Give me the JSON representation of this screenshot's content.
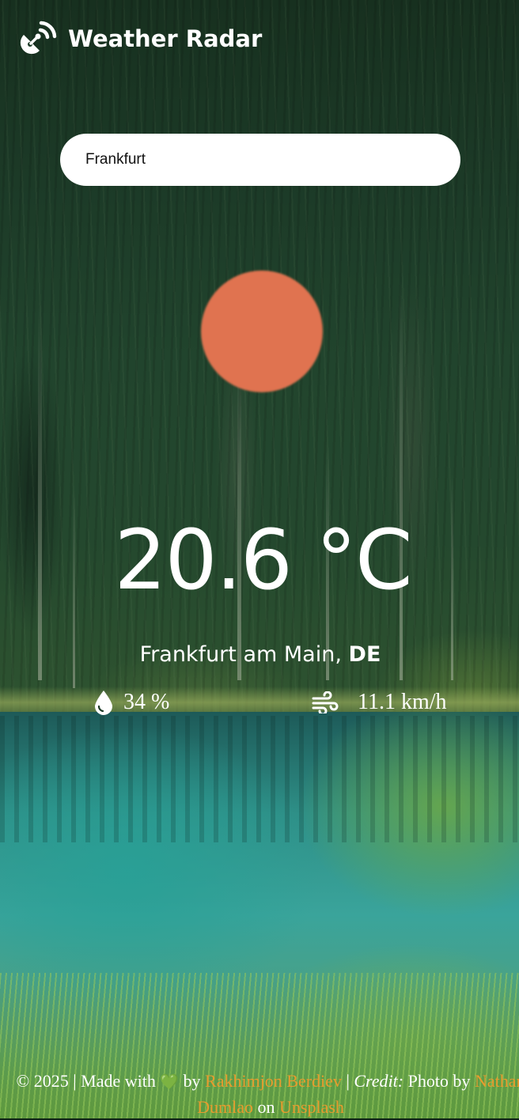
{
  "app": {
    "title": "Weather Radar",
    "logo_icon": "satellite-dish-icon"
  },
  "search": {
    "value": "Frankfurt",
    "placeholder": ""
  },
  "weather": {
    "condition_icon": "sun-icon",
    "condition_color": "#e07350",
    "temperature": "20.6 °C",
    "city": "Frankfurt am Main,",
    "country": "DE",
    "humidity_icon": "water-drop-icon",
    "humidity": "34 %",
    "wind_icon": "wind-icon",
    "wind": "11.1 km/h"
  },
  "footer": {
    "copyright": "© 2025 | Made with",
    "heart": "💚",
    "by": "by",
    "author": "Rakhimjon Berdiev",
    "separator": "|",
    "credit_label": "Credit:",
    "photo_by": "Photo by",
    "photographer": "Nathan Dumlao",
    "on": "on",
    "platform": "Unsplash"
  },
  "colors": {
    "link": "#e89b2e",
    "text": "#ffffff",
    "search_bg": "#ffffff"
  }
}
